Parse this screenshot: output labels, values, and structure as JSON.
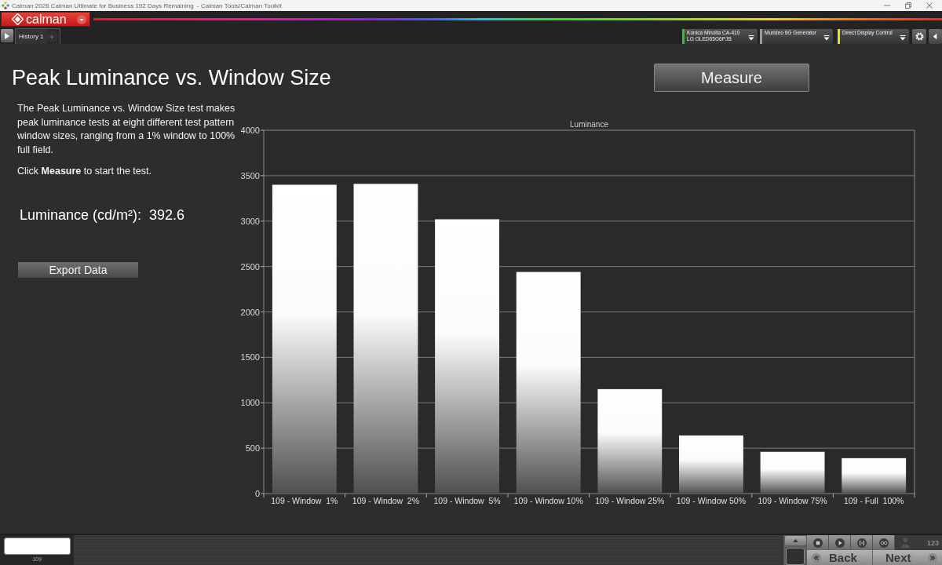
{
  "window": {
    "title": "Calman 2026 Calman Ultimate for Business 192 Days Remaining  - Calman Tools/Calman Toolkit"
  },
  "app_bar": {
    "logo": "calman",
    "tabs": [
      {
        "label": "History 1",
        "selected": true
      }
    ],
    "devices": [
      {
        "lines": [
          "Konica Minolta CA-410",
          "LG OLED65G6PJB"
        ],
        "color": "#22cc22"
      },
      {
        "lines": [
          "Murideo 6G Generator"
        ],
        "color": "#9a9a9a"
      },
      {
        "lines": [
          "Direct Display Control"
        ],
        "color": "#e6e600"
      }
    ]
  },
  "page": {
    "title": "Peak Luminance vs. Window Size",
    "measure_button": "Measure",
    "description": [
      "The Peak Luminance vs. Window Size test makes peak luminance tests at eight different test pattern window sizes, ranging from a 1% window to 100% full field.",
      "Click **Measure** to start the test."
    ],
    "reading": {
      "label": "Luminance (cd/m²):",
      "value": "392.6"
    },
    "export_button": "Export Data",
    "chart_data": {
      "type": "bar",
      "title": "Luminance",
      "categories": [
        "109 - Window  1%",
        "109 - Window  2%",
        "109 - Window  5%",
        "109 - Window 10%",
        "109 - Window 25%",
        "109 - Window 50%",
        "109 - Window 75%",
        "109 - Full  100%"
      ],
      "values": [
        3400,
        3410,
        3020,
        2440,
        1150,
        640,
        460,
        390
      ],
      "ylim": [
        0,
        4000
      ],
      "yticks": [
        0,
        500,
        1000,
        1500,
        2000,
        2500,
        3000,
        3500,
        4000
      ],
      "grid": true
    }
  },
  "footer": {
    "swatch_label": "109",
    "counter": "123",
    "back_button": "Back",
    "next_button": "Next"
  }
}
